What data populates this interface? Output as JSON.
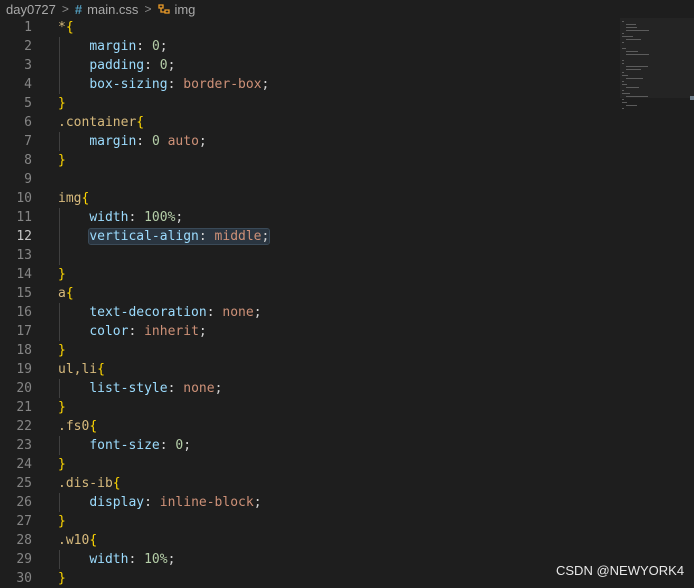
{
  "breadcrumb": {
    "folder": "day0727",
    "file": "main.css",
    "file_icon": "css-hash-icon",
    "symbol": "img",
    "symbol_icon": "css-selector-icon",
    "separator": ">"
  },
  "editor": {
    "current_line": 12,
    "lines": [
      {
        "n": "1",
        "tokens": [
          [
            "sel",
            "*"
          ],
          [
            "brace",
            "{"
          ]
        ]
      },
      {
        "n": "2",
        "tokens": [
          [
            "ws",
            "    "
          ],
          [
            "prop",
            "margin"
          ],
          [
            "punct",
            ": "
          ],
          [
            "num",
            "0"
          ],
          [
            "punct",
            ";"
          ]
        ]
      },
      {
        "n": "3",
        "tokens": [
          [
            "ws",
            "    "
          ],
          [
            "prop",
            "padding"
          ],
          [
            "punct",
            ": "
          ],
          [
            "num",
            "0"
          ],
          [
            "punct",
            ";"
          ]
        ]
      },
      {
        "n": "4",
        "tokens": [
          [
            "ws",
            "    "
          ],
          [
            "prop",
            "box-sizing"
          ],
          [
            "punct",
            ": "
          ],
          [
            "val",
            "border-box"
          ],
          [
            "punct",
            ";"
          ]
        ]
      },
      {
        "n": "5",
        "tokens": [
          [
            "brace",
            "}"
          ]
        ]
      },
      {
        "n": "6",
        "tokens": [
          [
            "sel",
            ".container"
          ],
          [
            "brace",
            "{"
          ]
        ]
      },
      {
        "n": "7",
        "tokens": [
          [
            "ws",
            "    "
          ],
          [
            "prop",
            "margin"
          ],
          [
            "punct",
            ": "
          ],
          [
            "num",
            "0"
          ],
          [
            "punct",
            " "
          ],
          [
            "val",
            "auto"
          ],
          [
            "punct",
            ";"
          ]
        ]
      },
      {
        "n": "8",
        "tokens": [
          [
            "brace",
            "}"
          ]
        ]
      },
      {
        "n": "9",
        "tokens": []
      },
      {
        "n": "10",
        "tokens": [
          [
            "sel",
            "img"
          ],
          [
            "brace",
            "{"
          ]
        ]
      },
      {
        "n": "11",
        "tokens": [
          [
            "ws",
            "    "
          ],
          [
            "prop",
            "width"
          ],
          [
            "punct",
            ": "
          ],
          [
            "num",
            "100%"
          ],
          [
            "punct",
            ";"
          ]
        ]
      },
      {
        "n": "12",
        "tokens": [
          [
            "ws",
            "    "
          ],
          [
            "hlprop",
            "vertical-align"
          ],
          [
            "hlpunct",
            ": "
          ],
          [
            "hlval",
            "middle"
          ],
          [
            "hlpunct",
            ";"
          ]
        ]
      },
      {
        "n": "13",
        "tokens": []
      },
      {
        "n": "14",
        "tokens": [
          [
            "brace",
            "}"
          ]
        ]
      },
      {
        "n": "15",
        "tokens": [
          [
            "sel",
            "a"
          ],
          [
            "brace",
            "{"
          ]
        ]
      },
      {
        "n": "16",
        "tokens": [
          [
            "ws",
            "    "
          ],
          [
            "prop",
            "text-decoration"
          ],
          [
            "punct",
            ": "
          ],
          [
            "val",
            "none"
          ],
          [
            "punct",
            ";"
          ]
        ]
      },
      {
        "n": "17",
        "tokens": [
          [
            "ws",
            "    "
          ],
          [
            "prop",
            "color"
          ],
          [
            "punct",
            ": "
          ],
          [
            "val",
            "inherit"
          ],
          [
            "punct",
            ";"
          ]
        ]
      },
      {
        "n": "18",
        "tokens": [
          [
            "brace",
            "}"
          ]
        ]
      },
      {
        "n": "19",
        "tokens": [
          [
            "sel",
            "ul,li"
          ],
          [
            "brace",
            "{"
          ]
        ]
      },
      {
        "n": "20",
        "tokens": [
          [
            "ws",
            "    "
          ],
          [
            "prop",
            "list-style"
          ],
          [
            "punct",
            ": "
          ],
          [
            "val",
            "none"
          ],
          [
            "punct",
            ";"
          ]
        ]
      },
      {
        "n": "21",
        "tokens": [
          [
            "brace",
            "}"
          ]
        ]
      },
      {
        "n": "22",
        "tokens": [
          [
            "sel",
            ".fs0"
          ],
          [
            "brace",
            "{"
          ]
        ]
      },
      {
        "n": "23",
        "tokens": [
          [
            "ws",
            "    "
          ],
          [
            "prop",
            "font-size"
          ],
          [
            "punct",
            ": "
          ],
          [
            "num",
            "0"
          ],
          [
            "punct",
            ";"
          ]
        ]
      },
      {
        "n": "24",
        "tokens": [
          [
            "brace",
            "}"
          ]
        ]
      },
      {
        "n": "25",
        "tokens": [
          [
            "sel",
            ".dis-ib"
          ],
          [
            "brace",
            "{"
          ]
        ]
      },
      {
        "n": "26",
        "tokens": [
          [
            "ws",
            "    "
          ],
          [
            "prop",
            "display"
          ],
          [
            "punct",
            ": "
          ],
          [
            "val",
            "inline-block"
          ],
          [
            "punct",
            ";"
          ]
        ]
      },
      {
        "n": "27",
        "tokens": [
          [
            "brace",
            "}"
          ]
        ]
      },
      {
        "n": "28",
        "tokens": [
          [
            "sel",
            ".w10"
          ],
          [
            "brace",
            "{"
          ]
        ]
      },
      {
        "n": "29",
        "tokens": [
          [
            "ws",
            "    "
          ],
          [
            "prop",
            "width"
          ],
          [
            "punct",
            ": "
          ],
          [
            "num",
            "10%"
          ],
          [
            "punct",
            ";"
          ]
        ]
      },
      {
        "n": "30",
        "tokens": [
          [
            "brace",
            "}"
          ]
        ]
      }
    ]
  },
  "colors": {
    "background": "#1e1e1e",
    "selector": "#d7ba7d",
    "brace": "#ffd700",
    "property": "#9cdcfe",
    "number": "#b5cea8",
    "value": "#ce9178",
    "line_number": "#858585"
  },
  "watermark": "CSDN @NEWYORK4"
}
